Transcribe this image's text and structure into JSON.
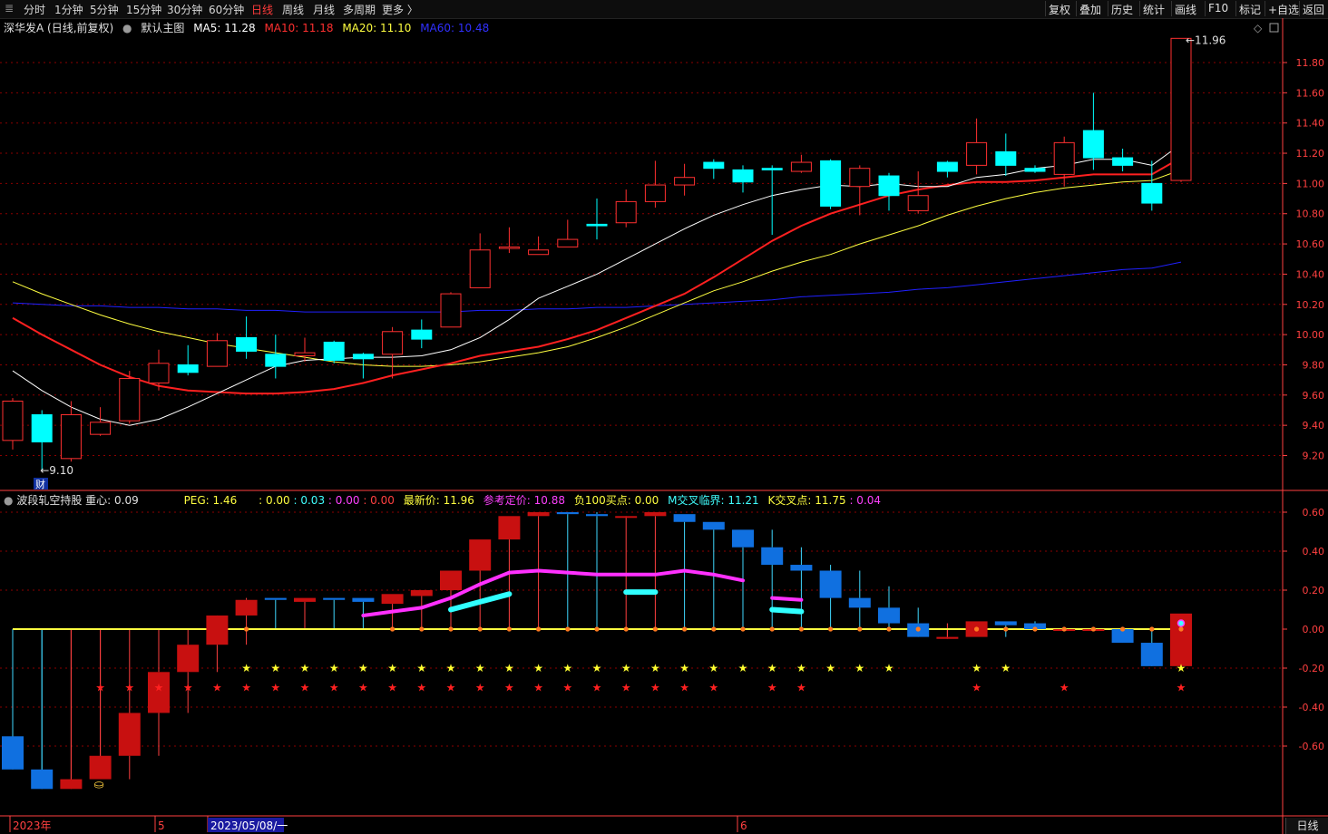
{
  "toolbar": {
    "left": [
      "分时",
      "1分钟",
      "5分钟",
      "15分钟",
      "30分钟",
      "60分钟",
      "日线",
      "周线",
      "月线",
      "多周期",
      "更多 〉"
    ],
    "active": "日线",
    "right": [
      "复权",
      "叠加",
      "历史",
      "统计",
      "画线",
      "F10",
      "标记",
      "+自选",
      "返回"
    ]
  },
  "main_info": {
    "title": "深华发A (日线,前复权)",
    "template": "默认主图",
    "ma5": "MA5: 11.28",
    "ma10": "MA10: 11.18",
    "ma20": "MA20: 11.10",
    "ma60": "MA60: 10.48"
  },
  "colors": {
    "up": "#ff3030",
    "down": "#00ffff",
    "ma5": "#ffffff",
    "ma10": "#ff2020",
    "ma20": "#ffff40",
    "ma60": "#2020ff",
    "grid": "#8b0000",
    "axis": "#ff4040"
  },
  "sub_info": {
    "name": "波段轧空持股",
    "zx": "重心: 0.09",
    "peg": "PEG: 1.46",
    "v1": ": 0.00",
    "v2": ": 0.03",
    "v3": ": 0.00",
    "v4": ": 0.00",
    "latest": "最新价: 11.96",
    "ref": "参考定价: 10.88",
    "neg": "负100买点: 0.00",
    "mcross": "M交叉临界: 11.21",
    "kcross_label": "K交叉点: 11.75",
    "kcross_val": ": 0.04"
  },
  "annotations": {
    "high": "11.96",
    "low": "9.10",
    "fin_marker": "财",
    "date_axis": [
      "2023年",
      "5",
      "2023/05/08/一",
      "6"
    ],
    "period_tab": "日线"
  },
  "chart_data": [
    {
      "type": "candlestick",
      "ylim": [
        9.0,
        12.0
      ],
      "yticks": [
        "11.80",
        "11.60",
        "11.40",
        "11.20",
        "11.00",
        "10.80",
        "10.60",
        "10.40",
        "10.20",
        "10.00",
        "9.80",
        "9.60",
        "9.40",
        "9.20"
      ],
      "candles": [
        {
          "o": 9.3,
          "h": 9.58,
          "l": 9.24,
          "c": 9.56
        },
        {
          "o": 9.47,
          "h": 9.5,
          "l": 9.1,
          "c": 9.29
        },
        {
          "o": 9.18,
          "h": 9.56,
          "l": 9.16,
          "c": 9.47
        },
        {
          "o": 9.34,
          "h": 9.52,
          "l": 9.33,
          "c": 9.42
        },
        {
          "o": 9.43,
          "h": 9.76,
          "l": 9.41,
          "c": 9.71
        },
        {
          "o": 9.68,
          "h": 9.9,
          "l": 9.63,
          "c": 9.81
        },
        {
          "o": 9.8,
          "h": 9.93,
          "l": 9.73,
          "c": 9.75
        },
        {
          "o": 9.79,
          "h": 10.01,
          "l": 9.79,
          "c": 9.96
        },
        {
          "o": 9.98,
          "h": 10.12,
          "l": 9.84,
          "c": 9.89
        },
        {
          "o": 9.87,
          "h": 10.0,
          "l": 9.71,
          "c": 9.79
        },
        {
          "o": 9.86,
          "h": 9.98,
          "l": 9.82,
          "c": 9.88
        },
        {
          "o": 9.95,
          "h": 9.96,
          "l": 9.81,
          "c": 9.83
        },
        {
          "o": 9.87,
          "h": 9.88,
          "l": 9.71,
          "c": 9.84
        },
        {
          "o": 9.87,
          "h": 10.05,
          "l": 9.71,
          "c": 10.02
        },
        {
          "o": 10.03,
          "h": 10.1,
          "l": 9.91,
          "c": 9.97
        },
        {
          "o": 10.05,
          "h": 10.28,
          "l": 10.05,
          "c": 10.27
        },
        {
          "o": 10.31,
          "h": 10.67,
          "l": 10.31,
          "c": 10.56
        },
        {
          "o": 10.57,
          "h": 10.71,
          "l": 10.54,
          "c": 10.58
        },
        {
          "o": 10.53,
          "h": 10.65,
          "l": 10.53,
          "c": 10.56
        },
        {
          "o": 10.58,
          "h": 10.76,
          "l": 10.58,
          "c": 10.63
        },
        {
          "o": 10.73,
          "h": 10.9,
          "l": 10.63,
          "c": 10.72
        },
        {
          "o": 10.74,
          "h": 10.96,
          "l": 10.71,
          "c": 10.88
        },
        {
          "o": 10.88,
          "h": 11.15,
          "l": 10.84,
          "c": 10.99
        },
        {
          "o": 10.99,
          "h": 11.13,
          "l": 10.92,
          "c": 11.04
        },
        {
          "o": 11.14,
          "h": 11.16,
          "l": 11.03,
          "c": 11.1
        },
        {
          "o": 11.09,
          "h": 11.12,
          "l": 10.94,
          "c": 11.01
        },
        {
          "o": 11.1,
          "h": 11.12,
          "l": 10.66,
          "c": 11.09
        },
        {
          "o": 11.08,
          "h": 11.19,
          "l": 11.07,
          "c": 11.14
        },
        {
          "o": 11.15,
          "h": 11.16,
          "l": 10.83,
          "c": 10.85
        },
        {
          "o": 10.98,
          "h": 11.12,
          "l": 10.79,
          "c": 11.1
        },
        {
          "o": 11.05,
          "h": 11.07,
          "l": 10.82,
          "c": 10.92
        },
        {
          "o": 10.82,
          "h": 11.08,
          "l": 10.8,
          "c": 10.92
        },
        {
          "o": 11.14,
          "h": 11.15,
          "l": 11.04,
          "c": 11.08
        },
        {
          "o": 11.12,
          "h": 11.43,
          "l": 11.06,
          "c": 11.27
        },
        {
          "o": 11.21,
          "h": 11.33,
          "l": 11.05,
          "c": 11.12
        },
        {
          "o": 11.1,
          "h": 11.12,
          "l": 11.07,
          "c": 11.08
        },
        {
          "o": 11.06,
          "h": 11.31,
          "l": 10.98,
          "c": 11.27
        },
        {
          "o": 11.35,
          "h": 11.6,
          "l": 11.09,
          "c": 11.17
        },
        {
          "o": 11.17,
          "h": 11.23,
          "l": 11.08,
          "c": 11.12
        },
        {
          "o": 11.0,
          "h": 11.15,
          "l": 10.82,
          "c": 10.87
        },
        {
          "o": 11.02,
          "h": 11.96,
          "l": 11.01,
          "c": 11.96
        }
      ],
      "ma5": [
        9.76,
        9.63,
        9.52,
        9.44,
        9.4,
        9.44,
        9.52,
        9.61,
        9.7,
        9.79,
        9.83,
        9.84,
        9.85,
        9.85,
        9.86,
        9.9,
        9.98,
        10.1,
        10.24,
        10.32,
        10.4,
        10.5,
        10.6,
        10.7,
        10.79,
        10.86,
        10.92,
        10.96,
        10.99,
        10.98,
        11.0,
        10.98,
        10.98,
        11.04,
        11.06,
        11.1,
        11.12,
        11.16,
        11.16,
        11.12,
        11.26
      ],
      "ma10": [
        10.11,
        10.0,
        9.9,
        9.8,
        9.72,
        9.66,
        9.63,
        9.62,
        9.61,
        9.61,
        9.62,
        9.64,
        9.68,
        9.73,
        9.77,
        9.81,
        9.86,
        9.89,
        9.92,
        9.97,
        10.03,
        10.11,
        10.19,
        10.27,
        10.38,
        10.5,
        10.62,
        10.72,
        10.8,
        10.86,
        10.92,
        10.96,
        10.99,
        11.01,
        11.01,
        11.02,
        11.04,
        11.06,
        11.06,
        11.06,
        11.17
      ],
      "ma20": [
        10.35,
        10.27,
        10.2,
        10.13,
        10.07,
        10.02,
        9.98,
        9.94,
        9.91,
        9.88,
        9.85,
        9.82,
        9.8,
        9.79,
        9.79,
        9.8,
        9.82,
        9.85,
        9.88,
        9.92,
        9.98,
        10.05,
        10.13,
        10.21,
        10.29,
        10.35,
        10.42,
        10.48,
        10.53,
        10.6,
        10.66,
        10.72,
        10.79,
        10.85,
        10.9,
        10.94,
        10.97,
        10.99,
        11.01,
        11.02,
        11.09
      ],
      "ma60": [
        10.21,
        10.2,
        10.19,
        10.19,
        10.18,
        10.18,
        10.17,
        10.17,
        10.16,
        10.16,
        10.15,
        10.15,
        10.15,
        10.15,
        10.15,
        10.15,
        10.16,
        10.16,
        10.17,
        10.17,
        10.18,
        10.18,
        10.19,
        10.2,
        10.21,
        10.22,
        10.23,
        10.25,
        10.26,
        10.27,
        10.28,
        10.3,
        10.31,
        10.33,
        10.35,
        10.37,
        10.39,
        10.41,
        10.43,
        10.44,
        10.48
      ]
    },
    {
      "type": "bar",
      "ylim": [
        -0.8,
        0.6
      ],
      "yticks": [
        "0.60",
        "0.40",
        "0.20",
        "0.00",
        "-0.20",
        "-0.40",
        "-0.60"
      ],
      "bars": [
        {
          "top": -0.55,
          "bottom": -0.72,
          "up": false
        },
        {
          "top": -0.72,
          "bottom": -0.82,
          "up": false
        },
        {
          "top": -0.77,
          "bottom": -0.82,
          "up": true
        },
        {
          "top": -0.65,
          "bottom": -0.77,
          "up": true
        },
        {
          "top": -0.43,
          "bottom": -0.65,
          "up": true
        },
        {
          "top": -0.22,
          "bottom": -0.43,
          "up": true
        },
        {
          "top": -0.08,
          "bottom": -0.22,
          "up": true
        },
        {
          "top": 0.07,
          "bottom": -0.08,
          "up": true
        },
        {
          "top": 0.15,
          "bottom": 0.07,
          "up": true
        },
        {
          "top": 0.16,
          "bottom": 0.15,
          "up": false
        },
        {
          "top": 0.16,
          "bottom": 0.14,
          "up": true
        },
        {
          "top": 0.16,
          "bottom": 0.15,
          "up": false
        },
        {
          "top": 0.16,
          "bottom": 0.14,
          "up": false
        },
        {
          "top": 0.18,
          "bottom": 0.13,
          "up": true
        },
        {
          "top": 0.2,
          "bottom": 0.17,
          "up": true
        },
        {
          "top": 0.3,
          "bottom": 0.2,
          "up": true
        },
        {
          "top": 0.46,
          "bottom": 0.3,
          "up": true
        },
        {
          "top": 0.58,
          "bottom": 0.46,
          "up": true
        },
        {
          "top": 0.6,
          "bottom": 0.58,
          "up": true
        },
        {
          "top": 0.6,
          "bottom": 0.59,
          "up": false
        },
        {
          "top": 0.59,
          "bottom": 0.58,
          "up": false
        },
        {
          "top": 0.58,
          "bottom": 0.58,
          "up": true
        },
        {
          "top": 0.6,
          "bottom": 0.58,
          "up": true
        },
        {
          "top": 0.59,
          "bottom": 0.55,
          "up": false
        },
        {
          "top": 0.55,
          "bottom": 0.51,
          "up": false
        },
        {
          "top": 0.51,
          "bottom": 0.42,
          "up": false
        },
        {
          "top": 0.42,
          "bottom": 0.33,
          "up": false
        },
        {
          "top": 0.33,
          "bottom": 0.3,
          "up": false
        },
        {
          "top": 0.3,
          "bottom": 0.16,
          "up": false
        },
        {
          "top": 0.16,
          "bottom": 0.11,
          "up": false
        },
        {
          "top": 0.11,
          "bottom": 0.03,
          "up": false
        },
        {
          "top": 0.03,
          "bottom": -0.04,
          "up": false
        },
        {
          "top": -0.04,
          "bottom": -0.05,
          "up": true
        },
        {
          "top": 0.04,
          "bottom": -0.04,
          "up": true
        },
        {
          "top": 0.04,
          "bottom": 0.02,
          "up": false
        },
        {
          "top": 0.03,
          "bottom": 0.0,
          "up": false
        },
        {
          "top": 0.0,
          "bottom": 0.0,
          "up": true
        },
        {
          "top": 0.0,
          "bottom": 0.0,
          "up": true
        },
        {
          "top": 0.0,
          "bottom": -0.07,
          "up": false
        },
        {
          "top": -0.07,
          "bottom": -0.19,
          "up": false
        },
        {
          "top": 0.08,
          "bottom": -0.19,
          "up": true
        }
      ],
      "wick_tops": [
        0.0,
        0.0,
        0.0,
        0.0,
        0.0,
        0.0,
        0.0,
        0.06,
        0.16,
        0.16,
        0.16,
        0.16,
        0.16,
        0.18,
        0.2,
        0.3,
        0.46,
        0.58,
        0.6,
        0.6,
        0.6,
        0.58,
        0.6,
        0.59,
        0.55,
        0.51,
        0.51,
        0.42,
        0.33,
        0.3,
        0.22,
        0.11,
        0.03,
        0.04,
        0.04,
        0.04,
        0.0,
        0.0,
        0.0,
        -0.07,
        0.08
      ],
      "wick_bottoms": [
        0.0,
        0.0,
        0.0,
        0.0,
        -0.77,
        -0.65,
        -0.43,
        -0.22,
        -0.08,
        0.0,
        0.0,
        0.0,
        0.0,
        0.0,
        0.0,
        0.0,
        0.0,
        0.0,
        0.0,
        0.0,
        0.0,
        0.0,
        0.0,
        0.0,
        0.0,
        0.0,
        0.0,
        0.0,
        0.0,
        0.0,
        0.0,
        0.0,
        0.0,
        -0.04,
        -0.04,
        0.0,
        0.0,
        0.0,
        0.0,
        0.0,
        -0.19
      ],
      "magenta_line": [
        [
          12,
          0.07
        ],
        [
          13,
          0.09
        ],
        [
          14,
          0.11
        ],
        [
          15,
          0.16
        ],
        [
          16,
          0.23
        ],
        [
          17,
          0.29
        ],
        [
          18,
          0.3
        ],
        [
          19,
          0.29
        ],
        [
          20,
          0.28
        ],
        [
          21,
          0.28
        ],
        [
          22,
          0.28
        ],
        [
          23,
          0.3
        ],
        [
          24,
          0.28
        ],
        [
          25,
          0.25
        ]
      ],
      "magenta_short": [
        [
          26,
          0.16
        ],
        [
          27,
          0.15
        ]
      ],
      "cyan_segments": [
        [
          [
            15,
            0.1
          ],
          [
            16,
            0.14
          ],
          [
            17,
            0.18
          ]
        ],
        [
          [
            21,
            0.19
          ],
          [
            22,
            0.19
          ]
        ],
        [
          [
            26,
            0.1
          ],
          [
            27,
            0.09
          ]
        ]
      ],
      "yellow_star_cols": [
        8,
        9,
        10,
        11,
        12,
        13,
        14,
        15,
        16,
        17,
        18,
        19,
        20,
        21,
        22,
        23,
        24,
        25,
        26,
        27,
        28,
        29,
        30,
        33,
        34,
        40
      ],
      "red_star_cols": [
        3,
        4,
        5,
        6,
        7,
        8,
        9,
        10,
        11,
        12,
        13,
        14,
        15,
        16,
        17,
        18,
        19,
        20,
        21,
        22,
        23,
        24,
        26,
        27,
        33,
        36,
        40
      ],
      "orange_dot_cols": [
        8,
        13,
        14,
        15,
        16,
        17,
        18,
        19,
        20,
        21,
        22,
        23,
        24,
        25,
        26,
        27,
        28,
        29,
        30,
        31,
        33,
        34,
        35,
        36,
        37,
        38,
        39,
        40
      ]
    }
  ]
}
